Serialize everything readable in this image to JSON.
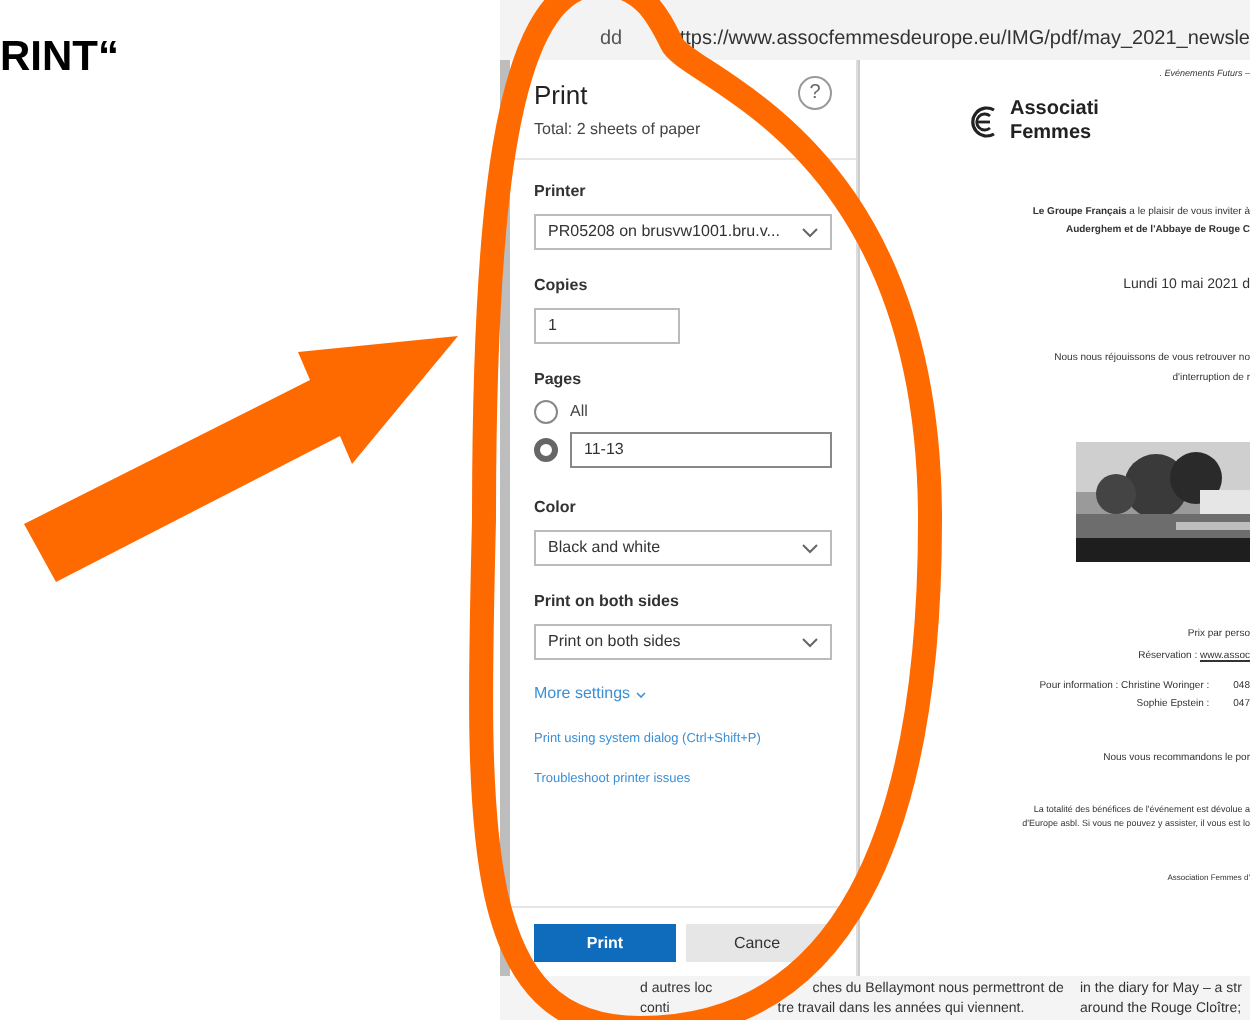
{
  "caption": "RINT“",
  "browser": {
    "tab_fragment": "dd",
    "url": "ttps://www.assocfemmesdeurope.eu/IMG/pdf/may_2021_newsle"
  },
  "print_panel": {
    "title": "Print",
    "subtitle": "Total: 2 sheets of paper",
    "help": "?",
    "printer": {
      "label": "Printer",
      "value": "PR05208 on brusvw1001.bru.v..."
    },
    "copies": {
      "label": "Copies",
      "value": "1"
    },
    "pages": {
      "label": "Pages",
      "options": [
        {
          "label": "All",
          "selected": false
        },
        {
          "value": "11-13",
          "selected": true
        }
      ]
    },
    "color": {
      "label": "Color",
      "value": "Black and white"
    },
    "both_sides": {
      "label": "Print on both sides",
      "value": "Print on both sides"
    },
    "more_settings": "More settings",
    "links": [
      "Print using system dialog (Ctrl+Shift+P)",
      "Troubleshoot printer issues"
    ],
    "buttons": [
      {
        "label": "Print",
        "kind": "primary"
      },
      {
        "label": "Cance",
        "kind": "secondary"
      }
    ]
  },
  "preview": {
    "header": ". Evénements Futurs – ",
    "logo_lines": [
      "Associati",
      "Femmes "
    ],
    "lines": [
      {
        "text": "**Le Groupe Français** a le plaisir de vous inviter à",
        "kind": "small"
      },
      {
        "text": "Auderghem et de l'Abbaye de Rouge C",
        "kind": "bold"
      },
      {
        "text": "Lundi 10 mai 2021 d",
        "kind": "large"
      },
      {
        "text": "Nous nous réjouissons de vous retrouver no",
        "kind": "small"
      },
      {
        "text": "d'interruption de r",
        "kind": "small"
      }
    ],
    "after_picture": [
      {
        "text": "Prix par perso",
        "kind": "small"
      },
      {
        "text": "Réservation : ",
        "link": "www.assoc",
        "kind": "small"
      }
    ],
    "contacts": [
      {
        "label": "Pour information : Christine Woringer :",
        "phone": "048"
      },
      {
        "label": "Sophie Epstein :",
        "phone": "047"
      }
    ],
    "recommend": "Nous vous recommandons le por",
    "footnotes": [
      "La totalité des bénéfices de l'événement est dévolue a",
      "d'Europe asbl. Si vous ne pouvez y assister, il vous est lo"
    ],
    "signature": "Association Femmes d'"
  },
  "background_text": {
    "left": [
      [
        "d autres loc",
        "ches du Bellaymont nous permettront de"
      ],
      [
        "conti",
        "tre travail dans les années qui viennent."
      ]
    ],
    "right": [
      "in the diary for May – a str",
      "around the Rouge Cloître; "
    ]
  }
}
